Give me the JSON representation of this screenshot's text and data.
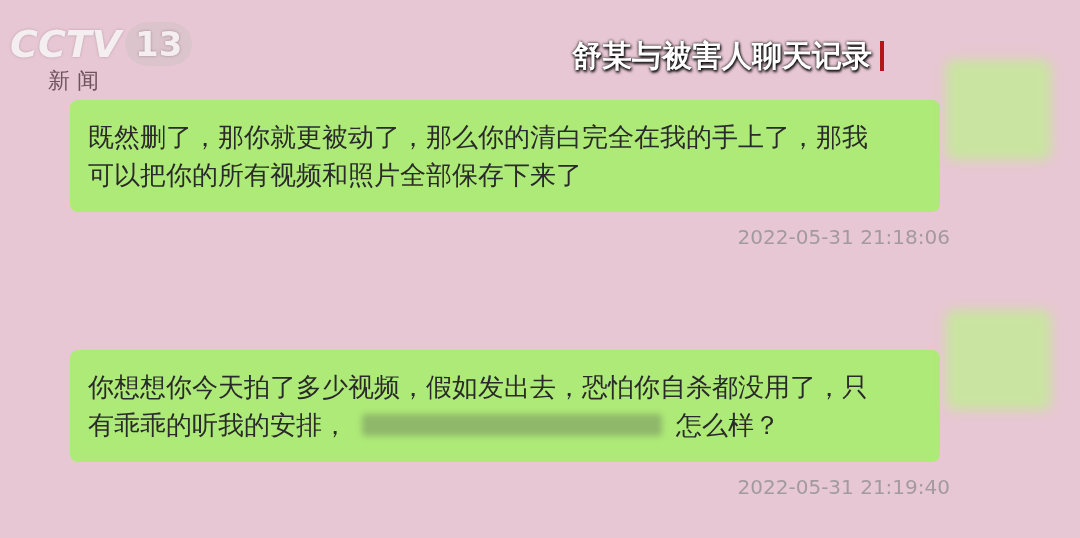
{
  "channel_logo": {
    "name": "CCTV",
    "number": "13",
    "subtitle": "新 闻"
  },
  "caption": "舒某与被害人聊天记录",
  "messages": [
    {
      "lines": [
        [
          {
            "kind": "text",
            "text": "既然删了，那你就更被动了，那么你的清白完全在我的手上了，那我"
          }
        ],
        [
          {
            "kind": "text",
            "text": "可以把你的所有视频和照片全部保存下来了"
          }
        ]
      ],
      "time": "2022-05-31 21:18:06"
    },
    {
      "lines": [
        [
          {
            "kind": "text",
            "text": "你想想你今天拍了多少视频，假如发出去，恐怕你自杀都没用了，只"
          }
        ],
        [
          {
            "kind": "text",
            "text": "有乖乖的听我的安排，"
          },
          {
            "kind": "redacted"
          },
          {
            "kind": "text",
            "text": "怎么样？"
          }
        ]
      ],
      "time": "2022-05-31 21:19:40"
    }
  ]
}
